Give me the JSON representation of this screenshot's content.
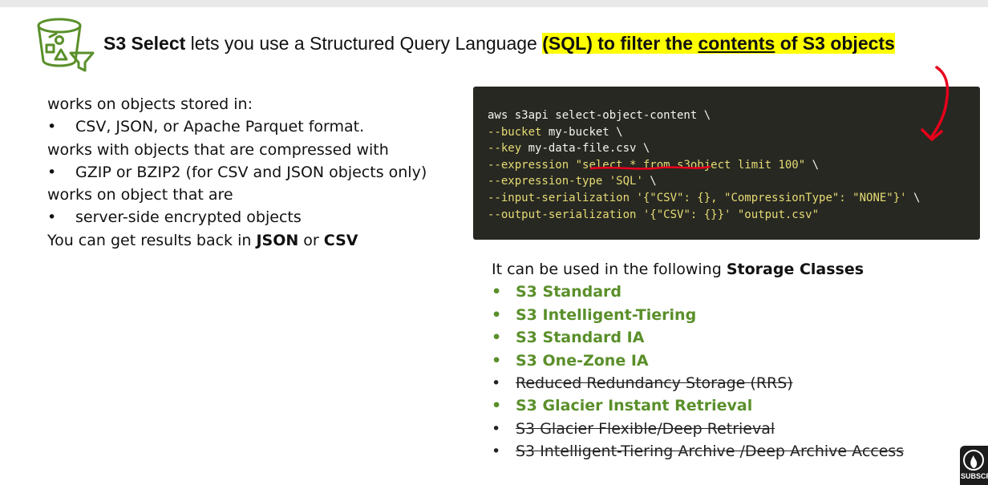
{
  "colors": {
    "accent_green": "#5a8f2a",
    "highlight": "#ffff00",
    "code_bg": "#272822",
    "code_option": "#e6db74",
    "annotation_red": "#e8001c"
  },
  "header": {
    "product": "S3 Select",
    "lead": " lets you use a Structured Query Language ",
    "hl_part1": "(SQL) to filter the ",
    "hl_underlined": "contents",
    "hl_part2": " of S3 objects"
  },
  "left": {
    "line1": "works on objects stored in:",
    "bullet1": "CSV, JSON, or Apache Parquet format.",
    "line2": "works with objects that are compressed with",
    "bullet2": "GZIP or BZIP2 (for CSV and JSON objects only)",
    "line3": "works on object that are",
    "bullet3": "server-side encrypted objects",
    "results_prefix": "You can get results back in ",
    "results_json": "JSON",
    "results_or": " or ",
    "results_csv": "CSV",
    "bullet_symbol": "•"
  },
  "code": {
    "l1": "aws s3api select-object-content \\",
    "l2_opt": "--bucket",
    "l2_val": " my-bucket \\",
    "l3_opt": "--key",
    "l3_val": " my-data-file.csv \\",
    "l4_opt": "--expression",
    "l4_str": " \"select * from s3object limit 100\"",
    "l4_end": " \\",
    "l5_opt": "--expression-type",
    "l5_str": " 'SQL'",
    "l5_end": " \\",
    "l6_opt": "--input-serialization",
    "l6_str": " '{\"CSV\": {}, \"CompressionType\": \"NONE\"}'",
    "l6_end": " \\",
    "l7_opt": "--output-serialization",
    "l7_str": " '{\"CSV\": {}}' \"output.csv\""
  },
  "storage": {
    "intro_prefix": "It can be used in the following ",
    "intro_bold": "Storage Classes",
    "bullet_symbol": "•",
    "classes": [
      {
        "label": "S3 Standard",
        "supported": true
      },
      {
        "label": "S3 Intelligent-Tiering",
        "supported": true
      },
      {
        "label": "S3 Standard IA",
        "supported": true
      },
      {
        "label": "S3 One-Zone IA",
        "supported": true
      },
      {
        "label": "Reduced Redundancy Storage (RRS)",
        "supported": false
      },
      {
        "label": "S3 Glacier Instant Retrieval",
        "supported": true
      },
      {
        "label": "S3 Glacier Flexible/Deep Retrieval",
        "supported": false
      },
      {
        "label": "S3 Intelligent-Tiering Archive /Deep Archive Access",
        "supported": false
      }
    ]
  },
  "subscribe": {
    "label": "SUBSCRI",
    "icon": "flame-logo-icon"
  }
}
